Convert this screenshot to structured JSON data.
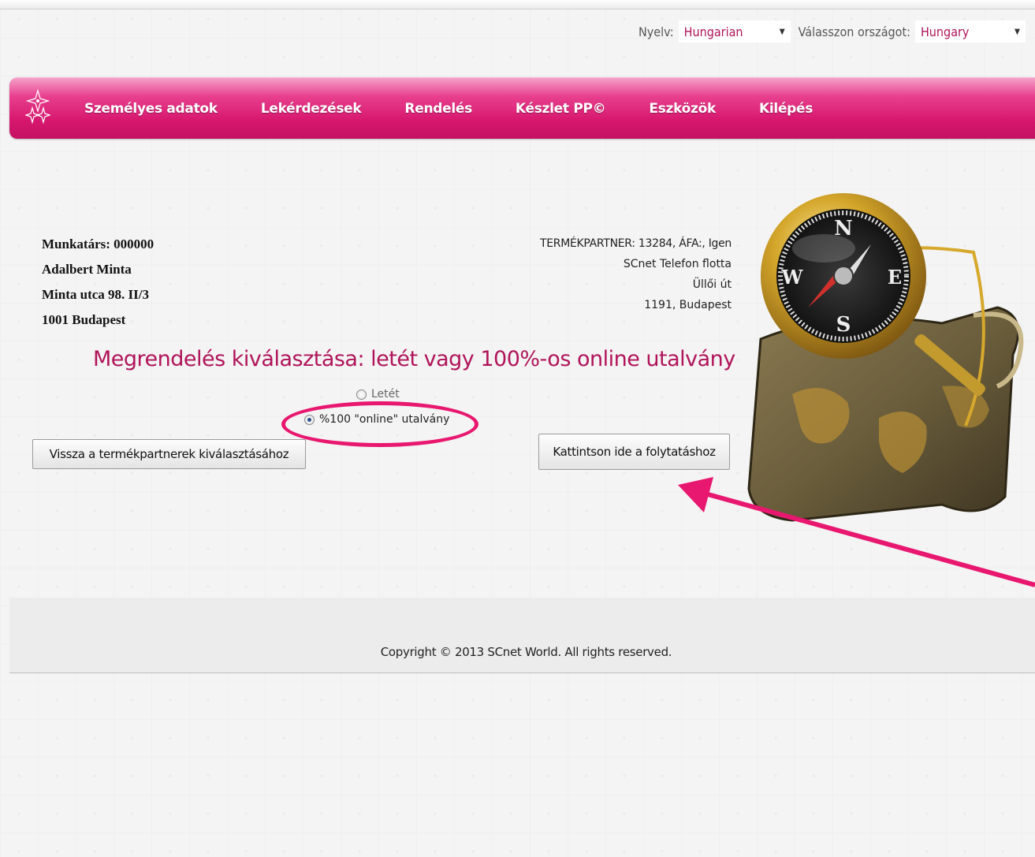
{
  "selectors": {
    "language_label": "Nyelv:",
    "language_value": "Hungarian",
    "country_label": "Válasszon országot:",
    "country_value": "Hungary"
  },
  "nav": {
    "items": [
      "Személyes adatok",
      "Lekérdezések",
      "Rendelés",
      "Készlet PP©",
      "Eszközök",
      "Kilépés"
    ]
  },
  "member": {
    "line1": "Munkatárs: 000000",
    "name": "Adalbert Minta",
    "street": "Minta utca 98. II/3",
    "city": "1001 Budapest"
  },
  "partner": {
    "line1": "TERMÉKPARTNER: 13284, ÁFA:, Igen",
    "line2": "SCnet Telefon flotta",
    "line3": "Üllői út",
    "line4": "1191, Budapest"
  },
  "heading": "Megrendelés kiválasztása: letét vagy 100%-os online utalvány",
  "options": {
    "letet": "Letét",
    "online": "%100 \"online\" utalvány",
    "selected": "online"
  },
  "buttons": {
    "back": "Vissza a termékpartnerek kiválasztásához",
    "continue": "Kattintson ide a folytatáshoz"
  },
  "footer": {
    "copyright": "Copyright © 2013 SCnet World. All rights reserved."
  },
  "colors": {
    "brand_magenta": "#d7176f",
    "annotation": "#e8176f",
    "heading": "#b0145a"
  }
}
